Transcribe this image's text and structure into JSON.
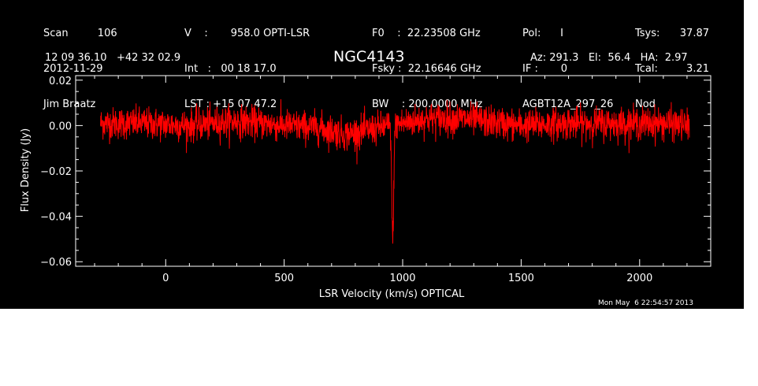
{
  "header": {
    "col1": [
      "Scan         106",
      "2012-11-29",
      "Jim Braatz"
    ],
    "col2": [
      "V    :       958.0 OPTI-LSR",
      "Int   :   00 18 17.0",
      "LST : +15 07 47.2"
    ],
    "col3": [
      "F0    :  22.23508 GHz",
      "Fsky :  22.16646 GHz",
      "BW    : 200.0000 MHz"
    ],
    "col4": [
      "Pol:      I",
      "IF :       0",
      "AGBT12A_297_26"
    ],
    "col5": [
      "Tsys:",
      "Tcal:",
      "Nod"
    ],
    "col6": [
      "37.87",
      "3.21",
      ""
    ],
    "coords": "12 09 36.10   +42 32 02.9",
    "source": "NGC4143",
    "azelha": "Az: 291.3   El:  56.4   HA:  2.97",
    "timestamp": "Mon May  6 22:54:57 2013"
  },
  "colors": {
    "background": "#000000",
    "axes": "#ffffff",
    "trace": "#ff0000"
  },
  "chart_data": {
    "type": "line",
    "title": "NGC4143",
    "xlabel": "LSR Velocity (km/s) OPTICAL",
    "ylabel": "Flux Density (Jy)",
    "xlim": [
      -380,
      2300
    ],
    "ylim": [
      -0.062,
      0.022
    ],
    "x_ticks": [
      0,
      500,
      1000,
      1500,
      2000
    ],
    "x_tick_labels": [
      "0",
      "500",
      "1000",
      "1500",
      "2000"
    ],
    "y_ticks": [
      0.02,
      0.0,
      -0.02,
      -0.04,
      -0.06
    ],
    "y_tick_labels": [
      "0.02",
      "0.00",
      "−0.02",
      "−0.04",
      "−0.06"
    ],
    "series": [
      {
        "x_range": [
          -275,
          2210
        ],
        "baseline_points": [
          [
            -275,
            0.001
          ],
          [
            -100,
            0.001
          ],
          [
            100,
            0.0
          ],
          [
            300,
            0.002
          ],
          [
            500,
            0.0
          ],
          [
            650,
            -0.001
          ],
          [
            760,
            -0.004
          ],
          [
            900,
            -0.001
          ],
          [
            1100,
            0.003
          ],
          [
            1250,
            0.003
          ],
          [
            1500,
            0.0
          ],
          [
            1700,
            0.001
          ],
          [
            1900,
            0.001
          ],
          [
            2100,
            0.001
          ],
          [
            2210,
            0.0
          ]
        ],
        "noise_rms": 0.0035,
        "absorption_feature": {
          "center": 958,
          "depth": -0.051,
          "width": 4
        }
      }
    ]
  }
}
